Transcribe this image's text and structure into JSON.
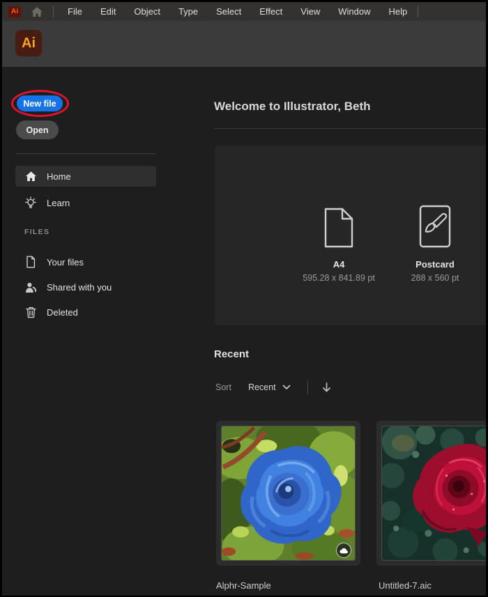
{
  "menubar": {
    "logo_text": "Ai",
    "items": [
      "File",
      "Edit",
      "Object",
      "Type",
      "Select",
      "Effect",
      "View",
      "Window",
      "Help"
    ]
  },
  "header": {
    "logo_text": "Ai"
  },
  "sidebar": {
    "new_file_button": "New file",
    "open_button": "Open",
    "nav_items": [
      {
        "label": "Home",
        "icon": "home-icon",
        "active": true
      },
      {
        "label": "Learn",
        "icon": "lightbulb-icon",
        "active": false
      }
    ],
    "files_section": {
      "heading": "FILES",
      "items": [
        {
          "label": "Your files",
          "icon": "document-icon"
        },
        {
          "label": "Shared with you",
          "icon": "person-icon"
        },
        {
          "label": "Deleted",
          "icon": "trash-icon"
        }
      ]
    }
  },
  "main": {
    "welcome_heading": "Welcome to Illustrator, Beth",
    "presets": [
      {
        "name": "A4",
        "size": "595.28 x 841.89 pt",
        "icon": "blank-document-icon"
      },
      {
        "name": "Postcard",
        "size": "288 x 560 pt",
        "icon": "paintbrush-document-icon"
      }
    ],
    "recent_section": {
      "heading": "Recent",
      "sort_label": "Sort",
      "sort_value": "Recent",
      "sort_direction_icon": "arrow-down-icon",
      "files": [
        {
          "name": "Alphr-Sample",
          "thumbnail": "blue-rose-artwork",
          "badge": "cloud-synced-icon"
        },
        {
          "name": "Untitled-7.aic",
          "thumbnail": "red-rose-artwork"
        }
      ]
    }
  },
  "annotation": {
    "shape": "ellipse",
    "highlights": "New file button",
    "color": "#e8112d"
  },
  "colors": {
    "accent_blue": "#1473e6",
    "annotation_red": "#e8112d",
    "logo_orange": "#ffa11c",
    "logo_maroon": "#471c11"
  }
}
